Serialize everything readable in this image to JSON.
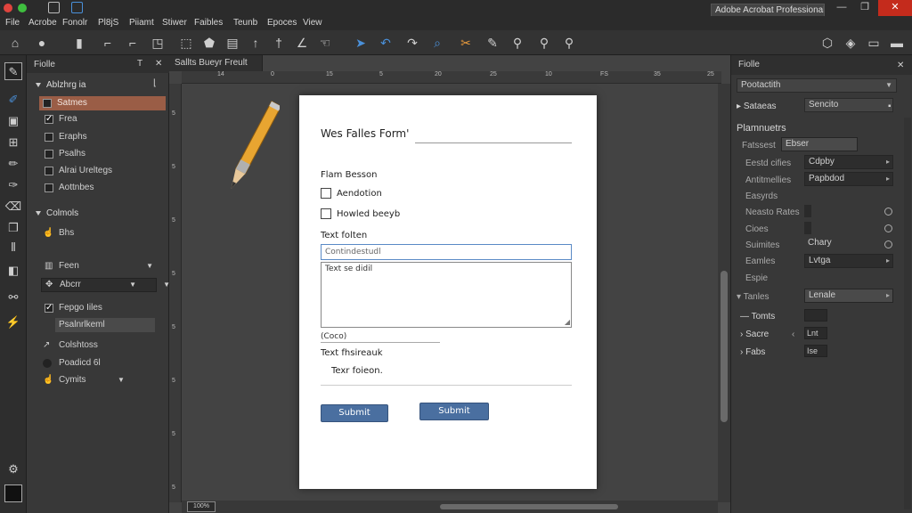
{
  "titlebar": {
    "app_title": "Adobe Acrobat Professional",
    "minimize": "—",
    "maximize": "❐",
    "close": "✕"
  },
  "menu": [
    "File",
    "Acrobe",
    "Fonolr",
    "Pl8jS",
    "Piiamt",
    "Stiwer",
    "Faibles",
    "Teunb",
    "Epoces",
    "View"
  ],
  "left_panel": {
    "title": "Fiolle",
    "pin": "T",
    "close": "✕",
    "section1": {
      "title": "Ablzhrg ia",
      "items": [
        {
          "label": "Satmes",
          "checked": false,
          "selected": true
        },
        {
          "label": "Frea",
          "checked": true,
          "selected": false
        },
        {
          "label": "Eraphs",
          "checked": false,
          "selected": false
        },
        {
          "label": "Psalhs",
          "checked": false,
          "selected": false
        },
        {
          "label": "Alrai Ureltegs",
          "checked": false,
          "selected": false
        },
        {
          "label": "Aottnbes",
          "checked": false,
          "selected": false
        }
      ]
    },
    "section2": {
      "title": "Colmols",
      "item1": "Bhs",
      "dd1": "Feen",
      "dd2": "Abcrr",
      "check_label": "Fepgo Iiles",
      "field_label": "Psalnrlkeml",
      "item_a": "Colshtoss",
      "item_b": "Poadicd 6l",
      "item_c": "Cymits"
    }
  },
  "document": {
    "tab": "Sallts Bueyr Freult",
    "ruler_top": [
      "14",
      "0",
      "15",
      "5",
      "20",
      "25",
      "10",
      "FS",
      "35",
      "25"
    ],
    "ruler_left": [
      "5",
      "5",
      "5",
      "5",
      "5",
      "5",
      "5",
      "5"
    ],
    "zoom": "100%",
    "form": {
      "title": "Wes Falles Form'",
      "section_label": "Flam Besson",
      "checkbox1": "Aendotion",
      "checkbox2": "Howled beeyb",
      "text_label": "Text folten",
      "input_placeholder": "Contindestudl",
      "textarea_value": "Text se didil",
      "small_field": "(Coco)",
      "text_label2": "Text fhsireauk",
      "indent_text": "Texr foieon.",
      "submit1": "Submit",
      "submit2": "Submit"
    }
  },
  "right_panel": {
    "title": "Fiolle",
    "dropdown": "Pootactith",
    "section_label": "Sataeas",
    "section_value": "Sencito",
    "heading": "Plamnuetrs",
    "rows": [
      {
        "label": "Fatssest",
        "value": "Ebser"
      },
      {
        "label": "Eestd cifies",
        "value": "Cdpby"
      },
      {
        "label": "Antitmellies",
        "value": "Papbdod"
      },
      {
        "label": "Easyrds",
        "value": ""
      },
      {
        "label": "Neasto Rates",
        "value": ""
      },
      {
        "label": "Cioes",
        "value": ""
      },
      {
        "label": "Suimites",
        "value": "Chary"
      },
      {
        "label": "Eamles",
        "value": "Lvtga"
      },
      {
        "label": "Espie",
        "value": ""
      }
    ],
    "sub_head": "Tanles",
    "sub_head_value": "Lenale",
    "tree": [
      {
        "label": "Tomts",
        "value": ""
      },
      {
        "label": "Sacre",
        "value": "Lnt"
      },
      {
        "label": "Fabs",
        "value": "Ise"
      }
    ]
  }
}
